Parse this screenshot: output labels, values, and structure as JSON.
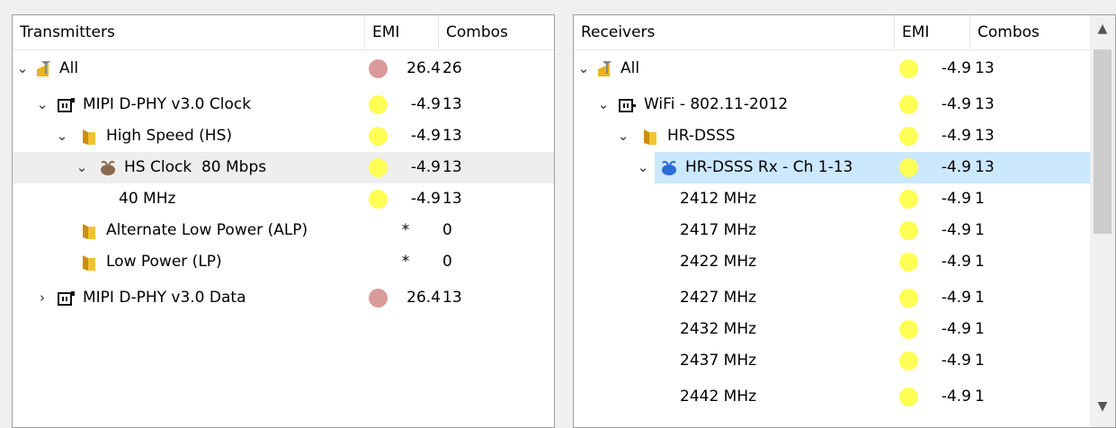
{
  "transmitters": {
    "headers": {
      "name": "Transmitters",
      "emi": "EMI",
      "combos": "Combos"
    },
    "rows": [
      {
        "label": "All",
        "chev": "⌄",
        "emi": "26.4",
        "combos": "26"
      },
      {
        "label": "MIPI D-PHY v3.0 Clock",
        "chev": "⌄",
        "emi": "-4.9",
        "combos": "13"
      },
      {
        "label": "High Speed (HS)",
        "chev": "⌄",
        "emi": "-4.9",
        "combos": "13"
      },
      {
        "label": "HS Clock  80 Mbps",
        "chev": "⌄",
        "emi": "-4.9",
        "combos": "13"
      },
      {
        "label": "40 MHz",
        "emi": "-4.9",
        "combos": "13"
      },
      {
        "label": "Alternate Low Power (ALP)",
        "emi": "*",
        "combos": "0"
      },
      {
        "label": "Low Power (LP)",
        "emi": "*",
        "combos": "0"
      },
      {
        "label": "MIPI D-PHY v3.0 Data",
        "chev": "›",
        "emi": "26.4",
        "combos": "13"
      }
    ]
  },
  "receivers": {
    "headers": {
      "name": "Receivers",
      "emi": "EMI",
      "combos": "Combos"
    },
    "rows": [
      {
        "label": "All",
        "chev": "⌄",
        "emi": "-4.9",
        "combos": "13"
      },
      {
        "label": "WiFi - 802.11-2012",
        "chev": "⌄",
        "emi": "-4.9",
        "combos": "13"
      },
      {
        "label": "HR-DSSS",
        "chev": "⌄",
        "emi": "-4.9",
        "combos": "13"
      },
      {
        "label": "HR-DSSS Rx - Ch 1-13",
        "chev": "⌄",
        "emi": "-4.9",
        "combos": "13"
      },
      {
        "label": "2412 MHz",
        "emi": "-4.9",
        "combos": "1"
      },
      {
        "label": "2417 MHz",
        "emi": "-4.9",
        "combos": "1"
      },
      {
        "label": "2422 MHz",
        "emi": "-4.9",
        "combos": "1"
      },
      {
        "label": "2427 MHz",
        "emi": "-4.9",
        "combos": "1"
      },
      {
        "label": "2432 MHz",
        "emi": "-4.9",
        "combos": "1"
      },
      {
        "label": "2437 MHz",
        "emi": "-4.9",
        "combos": "1"
      },
      {
        "label": "2442 MHz",
        "emi": "-4.9",
        "combos": "1"
      }
    ]
  },
  "icons": {
    "all": "antenna-icon",
    "device": "chip-icon",
    "folder": "folder-icon",
    "tx_source": "clock-source-icon",
    "rx_source": "receiver-source-icon"
  },
  "colors": {
    "yellow": "#ffff55",
    "red": "#d99a9a",
    "selected_blue": "#cce8ff"
  }
}
